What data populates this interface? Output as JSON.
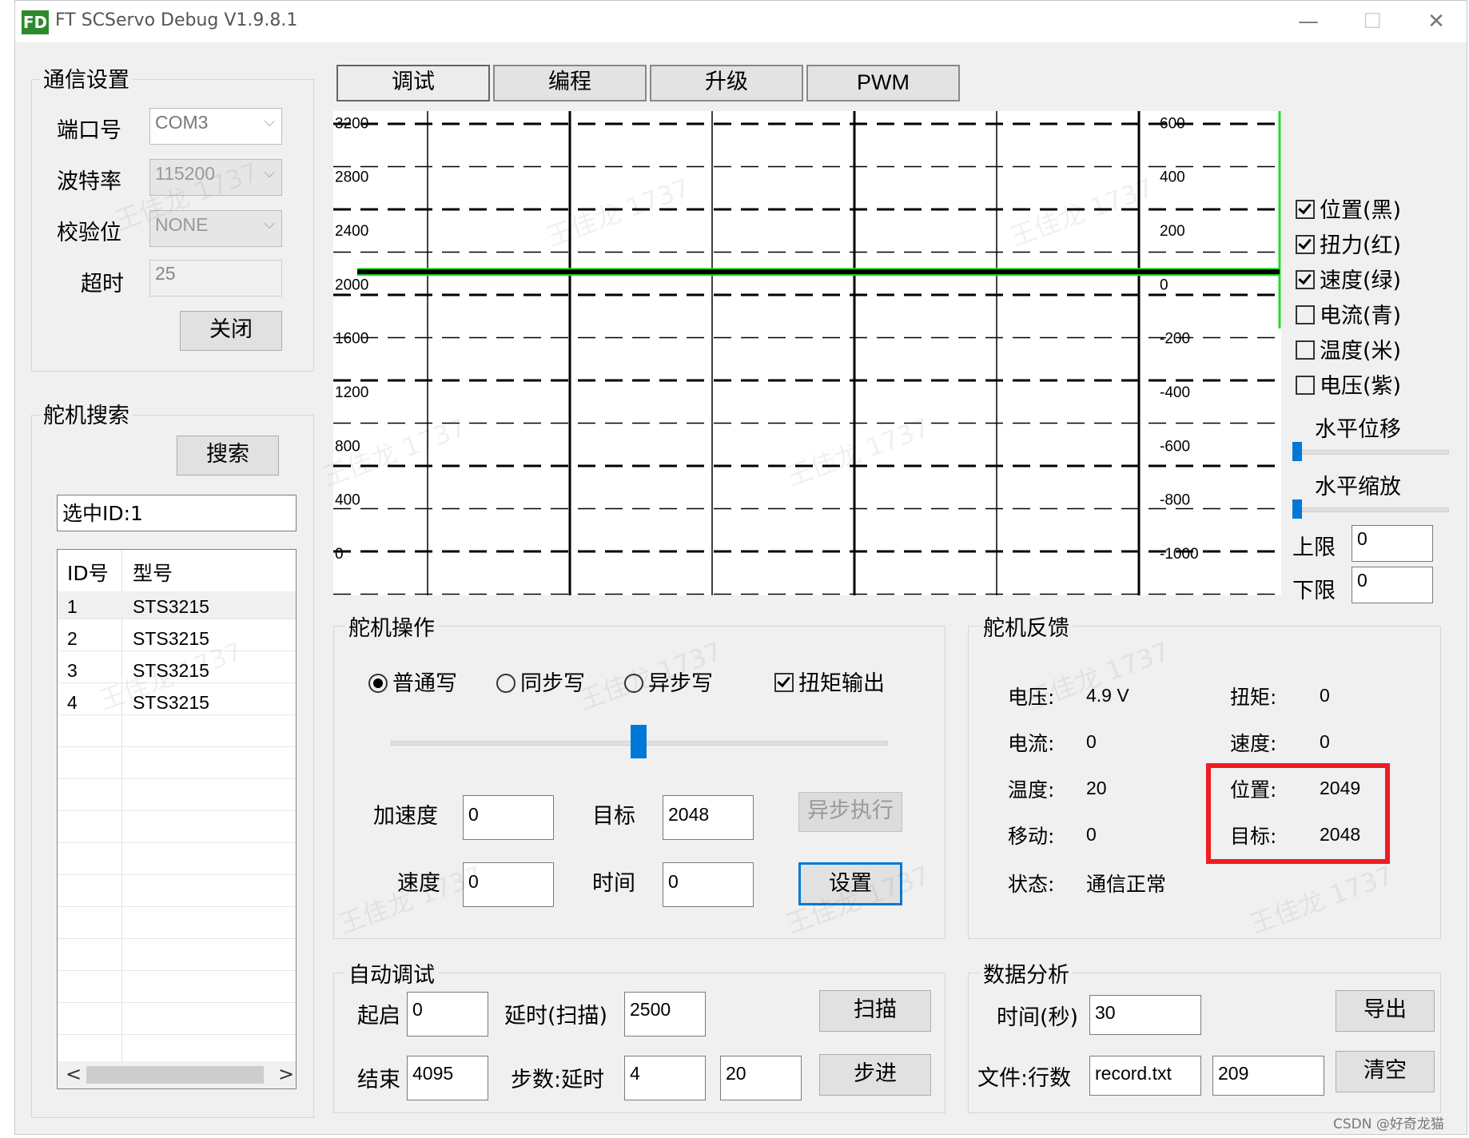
{
  "window": {
    "title": "FT SCServo Debug V1.9.8.1",
    "icon_text": "FD",
    "minimize": "—",
    "maximize": "☐",
    "close": "✕"
  },
  "comm": {
    "title": "通信设置",
    "port_label": "端口号",
    "port_value": "COM3",
    "baud_label": "波特率",
    "baud_value": "115200",
    "parity_label": "校验位",
    "parity_value": "NONE",
    "timeout_label": "超时",
    "timeout_value": "25",
    "close_button": "关闭"
  },
  "search": {
    "title": "舵机搜索",
    "search_button": "搜索",
    "selected_id": "选中ID:1",
    "columns": [
      "ID号",
      "型号"
    ],
    "rows": [
      {
        "id": "1",
        "model": "STS3215"
      },
      {
        "id": "2",
        "model": "STS3215"
      },
      {
        "id": "3",
        "model": "STS3215"
      },
      {
        "id": "4",
        "model": "STS3215"
      }
    ],
    "scroll_left": "<",
    "scroll_right": ">"
  },
  "tabs": [
    {
      "label": "调试",
      "active": true
    },
    {
      "label": "编程",
      "active": false
    },
    {
      "label": "升级",
      "active": false
    },
    {
      "label": "PWM",
      "active": false
    }
  ],
  "chart_data": {
    "type": "line",
    "left_ticks": [
      "3200",
      "2800",
      "2400",
      "2000",
      "1600",
      "1200",
      "800",
      "400",
      "0"
    ],
    "right_ticks": [
      "600",
      "400",
      "200",
      "0",
      "-200",
      "-400",
      "-600",
      "-800",
      "-1000"
    ],
    "ylim_left": [
      0,
      3600
    ],
    "ylim_right": [
      -1000,
      800
    ],
    "grid": true,
    "series": [
      {
        "name": "位置(黑)",
        "color": "#000000",
        "axis": "left",
        "values": [
          2049,
          2049
        ]
      },
      {
        "name": "速度(绿)",
        "color": "#22dd22",
        "axis": "left",
        "values": [
          2048,
          2048
        ]
      }
    ]
  },
  "legend": {
    "items": [
      {
        "label": "位置(黑)",
        "checked": true
      },
      {
        "label": "扭力(红)",
        "checked": true
      },
      {
        "label": "速度(绿)",
        "checked": true
      },
      {
        "label": "电流(青)",
        "checked": false
      },
      {
        "label": "温度(米)",
        "checked": false
      },
      {
        "label": "电压(紫)",
        "checked": false
      }
    ],
    "h_shift_label": "水平位移",
    "h_shift_value": 0,
    "h_zoom_label": "水平缩放",
    "h_zoom_value": 0,
    "upper_label": "上限",
    "upper_value": "0",
    "lower_label": "下限",
    "lower_value": "0"
  },
  "operation": {
    "title": "舵机操作",
    "mode_normal": "普通写",
    "mode_sync": "同步写",
    "mode_async": "异步写",
    "torque_output": "扭矩输出",
    "slider_fraction": 0.5,
    "accel_label": "加速度",
    "accel_value": "0",
    "target_label": "目标",
    "target_value": "2048",
    "async_exec_button": "异步执行",
    "speed_label": "速度",
    "speed_value": "0",
    "time_label": "时间",
    "time_value": "0",
    "set_button": "设置"
  },
  "feedback": {
    "title": "舵机反馈",
    "voltage_label": "电压:",
    "voltage_value": "4.9 V",
    "torque_label": "扭矩:",
    "torque_value": "0",
    "current_label": "电流:",
    "current_value": "0",
    "speed_label": "速度:",
    "speed_value": "0",
    "temp_label": "温度:",
    "temp_value": "20",
    "position_label": "位置:",
    "position_value": "2049",
    "move_label": "移动:",
    "move_value": "0",
    "target_label": "目标:",
    "target_value": "2048",
    "status_label": "状态:",
    "status_value": "通信正常",
    "highlight_color": "#ee1c24"
  },
  "auto": {
    "title": "自动调试",
    "start_label": "起启",
    "start_value": "0",
    "delay_label": "延时(扫描)",
    "delay_value": "2500",
    "scan_button": "扫描",
    "end_label": "结束",
    "end_value": "4095",
    "step_label": "步数:延时",
    "step_value": "4",
    "step_delay_value": "20",
    "step_button": "步进"
  },
  "analysis": {
    "title": "数据分析",
    "time_label": "时间(秒)",
    "time_value": "30",
    "export_button": "导出",
    "file_label": "文件:行数",
    "file_value": "record.txt",
    "rows_value": "209",
    "clear_button": "清空"
  },
  "watermark": {
    "text": "王佳龙 1737",
    "credit": "CSDN @好奇龙猫"
  }
}
